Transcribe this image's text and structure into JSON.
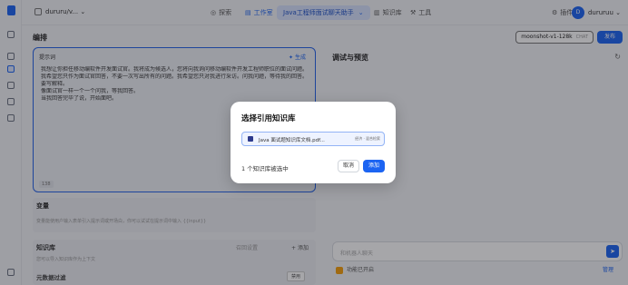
{
  "topbar": {
    "workspace": "dururu/v...",
    "nav": {
      "explore": "探索",
      "studio": "工作室",
      "knowledge": "知识库",
      "tools": "工具"
    },
    "breadcrumb": "Java工程师面试聊天助手",
    "plugin": "插件",
    "user_initial": "D",
    "user_name": "dururuu"
  },
  "editor": {
    "title": "编排",
    "prompt_label": "提示词",
    "generate": "生成",
    "prompt_lines": [
      "我想让你担任移动编软件开发面试官。我将成为候选人，您将向我询问移动编软件开发工程师职位的面试问题。",
      "我希望您只作为面试官回答，不要一次写出所有的问题。我希望您只对我进行采访。问我问题，等待我的回答。不",
      "要写解释。",
      "像面试官一样一个一个问我，等我回答。",
      "当我回答完毕了说，开始面吧。"
    ],
    "char_count": "138",
    "variables_title": "变量",
    "variables_desc": "变量能使用户输入表单引入提示词或开场白，你可以试试在提示词中输入 {{input}}",
    "kb_title": "知识库",
    "kb_recall": "召回设置",
    "kb_add": "添加",
    "kb_desc": "您可以导入知识库作为上下文",
    "metadata_filter": "元数据过滤",
    "metadata_select": "禁用"
  },
  "debug": {
    "model": "moonshot-v1-128k",
    "model_tag": "CHAT",
    "publish": "发布",
    "title": "调试与预览",
    "chat_placeholder": "和机器人聊天",
    "feature": "功能已开启",
    "manage": "管理"
  },
  "modal": {
    "title": "选择引用知识库",
    "file_name": "Java 面试题知识库文档.pdf...",
    "file_badge": "经济 · 混合检索",
    "selected_count": "1 个知识库被选中",
    "cancel": "取消",
    "add": "添加"
  }
}
